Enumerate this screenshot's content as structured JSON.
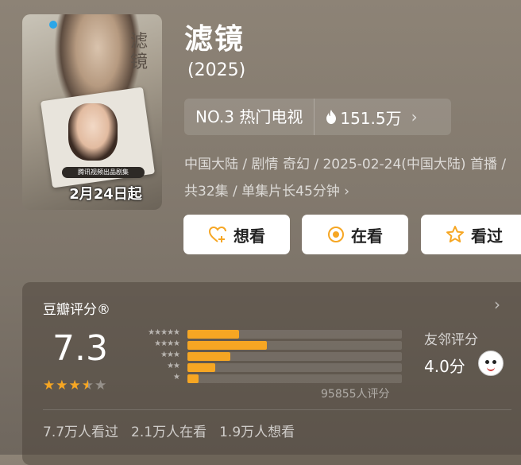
{
  "movie": {
    "title": "滤镜",
    "year": "(2025)",
    "poster": {
      "calligraphy": "滤镜",
      "pill_text": "腾讯视频出品剧集",
      "date_text": "2月24日起"
    },
    "rank": {
      "label": "NO.3 热门电视",
      "heat_icon": "flame-icon",
      "heat_value": "151.5万",
      "chevron": "›"
    },
    "meta_line": "中国大陆 / 剧情 奇幻 / 2025-02-24(中国大陆) 首播 / 共32集 / 单集片长45分钟",
    "meta_chevron": "›"
  },
  "actions": [
    {
      "label": "想看",
      "icon": "heart-plus-icon"
    },
    {
      "label": "在看",
      "icon": "target-icon"
    },
    {
      "label": "看过",
      "icon": "star-outline-icon"
    }
  ],
  "rating": {
    "header": "豆瓣评分®",
    "chevron": "›",
    "score": "7.3",
    "star_value": 3.5,
    "star_max": 5,
    "levels": [
      {
        "stars": "★★★★★",
        "fraction": 0.24
      },
      {
        "stars": "★★★★",
        "fraction": 0.37
      },
      {
        "stars": "★★★",
        "fraction": 0.2
      },
      {
        "stars": "★★",
        "fraction": 0.13
      },
      {
        "stars": "★",
        "fraction": 0.05
      }
    ],
    "count_text": "95855人评分",
    "friend_label": "友邻评分",
    "friend_score": "4.0分",
    "stats": [
      "7.7万人看过",
      "2.1万人在看",
      "1.9万人想看"
    ]
  },
  "colors": {
    "accent": "#f6a623",
    "background": "#857b6f"
  }
}
